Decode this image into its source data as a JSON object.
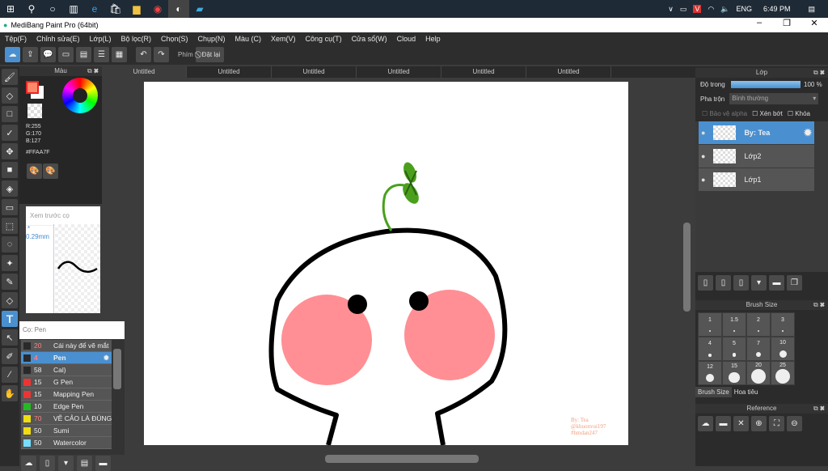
{
  "taskbar": {
    "time": "6:49 PM",
    "lang": "ENG"
  },
  "window": {
    "title": "MediBang Paint Pro (64bit)"
  },
  "menu": [
    "Tệp(F)",
    "Chỉnh sửa(E)",
    "Lớp(L)",
    "Bộ lọc(R)",
    "Chọn(S)",
    "Chụp(N)",
    "Màu (C)",
    "Xem(V)",
    "Công cụ(T)",
    "Cửa sổ(W)",
    "Cloud",
    "Help"
  ],
  "toolbar": {
    "phim_label": "Phím",
    "reset_label": "Đặt lại"
  },
  "tabs": [
    "Untitled",
    "Untitled",
    "Untitled",
    "Untitled",
    "Untitled",
    "Untitled"
  ],
  "color_panel": {
    "title": "Màu",
    "r": "R:255",
    "g": "G:170",
    "b": "B:127",
    "hex": "#FFAA7F",
    "fg_color": "#ff8a6a"
  },
  "preview_panel": {
    "title": "Xem trước cọ",
    "size": "* 0.29mm"
  },
  "brush_panel": {
    "title": "Cọ: Pen",
    "items": [
      {
        "size": "20",
        "name": "Cái này để vẽ mắt",
        "color": "#2a2a2a",
        "size_color": "#ff8080"
      },
      {
        "size": "4",
        "name": "Pen",
        "color": "#2a2a2a",
        "size_color": "#ff8080",
        "selected": true
      },
      {
        "size": "58",
        "name": "Cal)",
        "color": "#2a2a2a",
        "size_color": "#eee"
      },
      {
        "size": "15",
        "name": "G Pen",
        "color": "#ee3333",
        "size_color": "#eee"
      },
      {
        "size": "15",
        "name": "Mapping Pen",
        "color": "#ee3333",
        "size_color": "#eee"
      },
      {
        "size": "10",
        "name": "Edge Pen",
        "color": "#22bb22",
        "size_color": "#eee"
      },
      {
        "size": "70",
        "name": "VẼ CẢO LÀ ĐÚNG",
        "color": "#eedd11",
        "size_color": "#ff8080"
      },
      {
        "size": "50",
        "name": "Sumi",
        "color": "#eedd11",
        "size_color": "#eee"
      },
      {
        "size": "50",
        "name": "Watercolor",
        "color": "#77ddff",
        "size_color": "#eee"
      }
    ]
  },
  "layer_panel": {
    "title": "Lớp",
    "opacity_label": "Độ trong",
    "opacity_value": "100 %",
    "opacity": 100,
    "blend_label": "Pha trộn",
    "blend_value": "Bình thường",
    "protect_alpha": "Bảo vệ alpha",
    "clip": "Xén bớt",
    "lock": "Khóa",
    "layers": [
      {
        "name": "By: Tea",
        "selected": true
      },
      {
        "name": "Lớp2"
      },
      {
        "name": "Lớp1"
      }
    ]
  },
  "brush_size_panel": {
    "title": "Brush Size",
    "sizes": [
      "1",
      "1.5",
      "2",
      "3",
      "4",
      "5",
      "7",
      "10",
      "12",
      "15",
      "20",
      "25"
    ],
    "tab1": "Brush Size",
    "tab2": "Hoa tiêu"
  },
  "reference_panel": {
    "title": "Reference"
  },
  "canvas": {
    "signature": [
      "By: Tea",
      "@khuonvui197",
      "#hmdan247"
    ],
    "cheek_color": "#ff8f94",
    "sprout_color": "#4aa01c"
  }
}
